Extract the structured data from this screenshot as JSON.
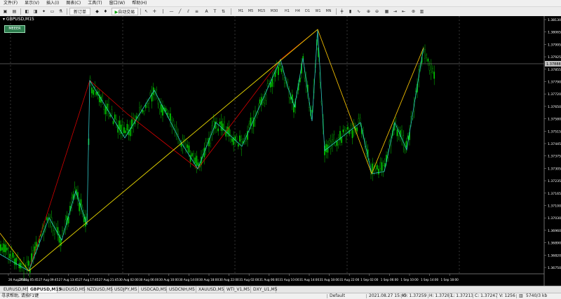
{
  "menu": [
    "文件(F)",
    "显示(V)",
    "插入(I)",
    "图表(C)",
    "工具(T)",
    "窗口(W)",
    "帮助(H)"
  ],
  "toolbar": {
    "new_order": "新订单",
    "autotrading": "自动交易",
    "timeframes": [
      "M1",
      "M5",
      "M15",
      "M30",
      "H1",
      "H4",
      "D1",
      "W1",
      "MN"
    ]
  },
  "chart": {
    "title": "GBPUSD,M15",
    "ea_badge": "MEEER",
    "current_price": "1.37888",
    "price_labels": [
      "1.38130",
      "1.38065",
      "1.37995",
      "1.37925",
      "1.37855",
      "1.37790",
      "1.37720",
      "1.37650",
      "1.37580",
      "1.37515",
      "1.37445",
      "1.37375",
      "1.37305",
      "1.37235",
      "1.37165",
      "1.37100",
      "1.37030",
      "1.36960",
      "1.36890",
      "1.36820",
      "1.36750"
    ],
    "time_labels": [
      "26 Aug 2021",
      "27 Aug 05:45",
      "27 Aug 09:45",
      "27 Aug 13:45",
      "27 Aug 17:45",
      "27 Aug 21:45",
      "30 Aug 02:00",
      "30 Aug 06:00",
      "30 Aug 10:00",
      "30 Aug 14:00",
      "30 Aug 18:00",
      "30 Aug 22:00",
      "31 Aug 02:00",
      "31 Aug 06:00",
      "31 Aug 10:00",
      "31 Aug 14:00",
      "31 Aug 18:00",
      "31 Aug 22:00",
      "1 Sep 02:00",
      "1 Sep 06:00",
      "1 Sep 10:00",
      "1 Sep 14:00",
      "1 Sep 18:00"
    ],
    "colors": {
      "candles": "#00c800",
      "zigzag_major": "#d40000",
      "zigzag_minor": "#2ec4c4",
      "trend": "#e0d000",
      "grid": "#5a5a5a",
      "price_line": "#a0a0a0"
    }
  },
  "tabs": [
    "EURUSD,M5",
    "GBPUSD,M15",
    "AUDUSD,M5",
    "NZDUSD,M5",
    "USDJPY,M5",
    "USDCAD,M5",
    "USDCNH,M5",
    "XAUUSD,M5",
    "WTI_V1,M5",
    "DXY_U1,M5"
  ],
  "status": {
    "help": "寻求帮助, 请按F1键",
    "profile": "Default",
    "datetime": "2021.08.27 15:45",
    "open": "O: 1.37259",
    "high": "H: 1.37287",
    "low": "L: 1.37213",
    "close": "C: 1.37247",
    "volume": "V: 1256",
    "traffic": "5740/3 kb"
  }
}
